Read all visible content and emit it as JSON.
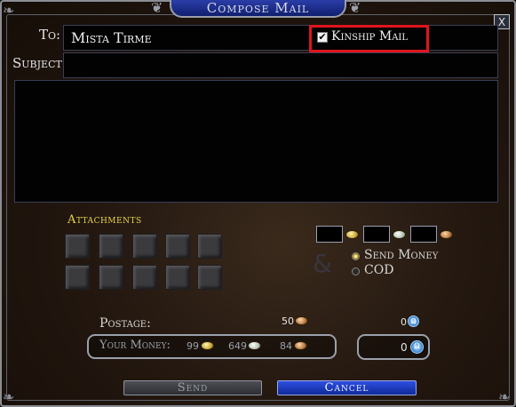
{
  "window": {
    "title": "Compose Mail",
    "close_label": "X"
  },
  "to": {
    "label": "To:",
    "value": "Mista Tirme"
  },
  "kinship": {
    "label": "Kinship Mail",
    "checked": true,
    "highlight_color": "#e0141e"
  },
  "subject": {
    "label": "Subject:",
    "value": ""
  },
  "message": {
    "value": ""
  },
  "attachments": {
    "label": "Attachments",
    "slot_count": 10
  },
  "money_entry": {
    "gold": "",
    "silver": "",
    "copper": "",
    "coin_icons": [
      "gold-coin-icon",
      "silver-coin-icon",
      "copper-coin-icon"
    ]
  },
  "payment_mode": {
    "options": [
      {
        "label": "Send Money",
        "selected": true
      },
      {
        "label": "COD",
        "selected": false
      }
    ]
  },
  "postage": {
    "label": "Postage:",
    "copper": "50",
    "points": "0"
  },
  "your_money": {
    "label": "Your Money:",
    "gold": "99",
    "silver": "649",
    "copper": "84"
  },
  "points_field": {
    "value": "0"
  },
  "buttons": {
    "send": "Send",
    "cancel": "Cancel"
  },
  "colors": {
    "title_blue": "#1f31a0",
    "attachments_yellow": "#e8d64a",
    "cancel_blue": "#2e4fe0"
  }
}
